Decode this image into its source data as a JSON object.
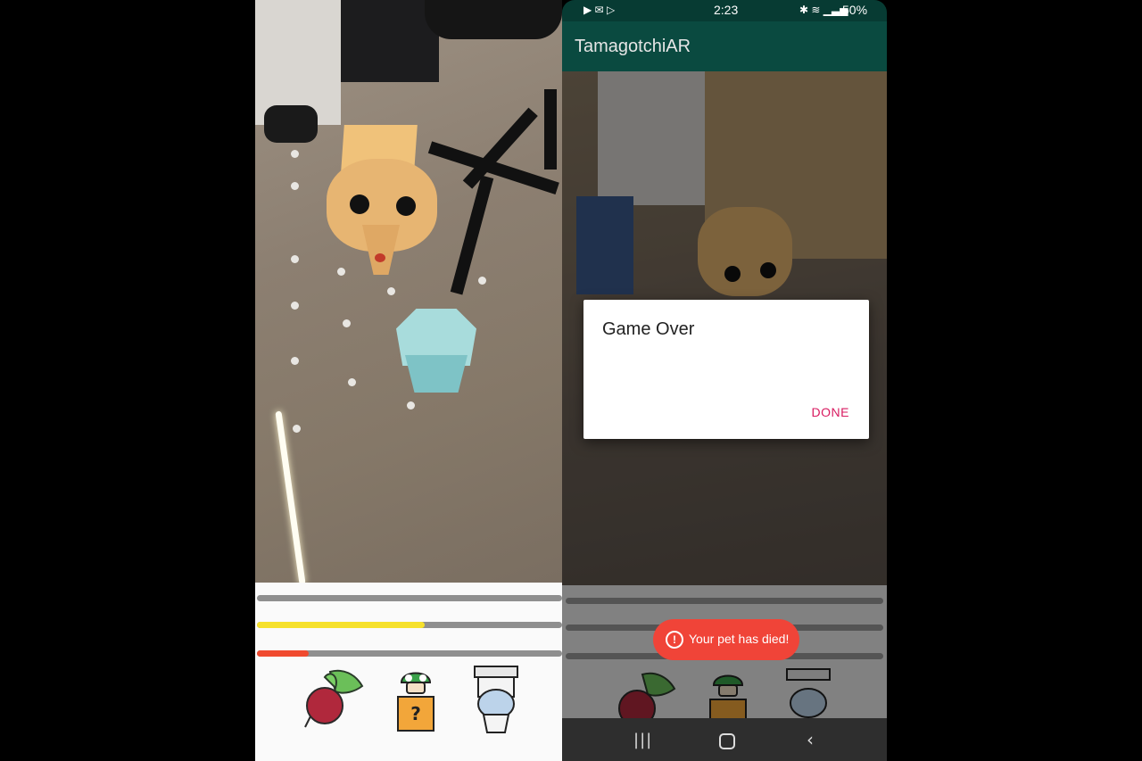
{
  "left_screen": {
    "bars": [
      {
        "name": "health",
        "fill": 0.0,
        "color": "#9a9a9a"
      },
      {
        "name": "hunger",
        "fill": 0.55,
        "color": "#f6e12c"
      },
      {
        "name": "energy",
        "fill": 0.17,
        "color": "#f04a2f"
      }
    ],
    "actions": [
      {
        "name": "feed",
        "icon": "radish-icon"
      },
      {
        "name": "play",
        "icon": "mushroom-block-icon"
      },
      {
        "name": "toilet",
        "icon": "toilet-icon"
      }
    ]
  },
  "right_screen": {
    "status": {
      "time": "2:23",
      "battery": "50%",
      "left_icons": [
        "youtube-icon",
        "gmail-icon",
        "play-store-icon"
      ],
      "right_icons": [
        "bluetooth-icon",
        "wifi-icon",
        "signal-icon"
      ]
    },
    "app_title": "TamagotchiAR",
    "dialog": {
      "title": "Game Over",
      "button": "DONE"
    },
    "toast": {
      "icon": "alert-icon",
      "message": "Your pet has died!"
    },
    "navbar": [
      "recents-button",
      "home-button",
      "back-button"
    ]
  },
  "colors": {
    "appbar": "#0a4a40",
    "accent": "#d81b60",
    "toast": "#f04438",
    "hunger": "#f6e12c",
    "energy": "#f04a2f"
  }
}
